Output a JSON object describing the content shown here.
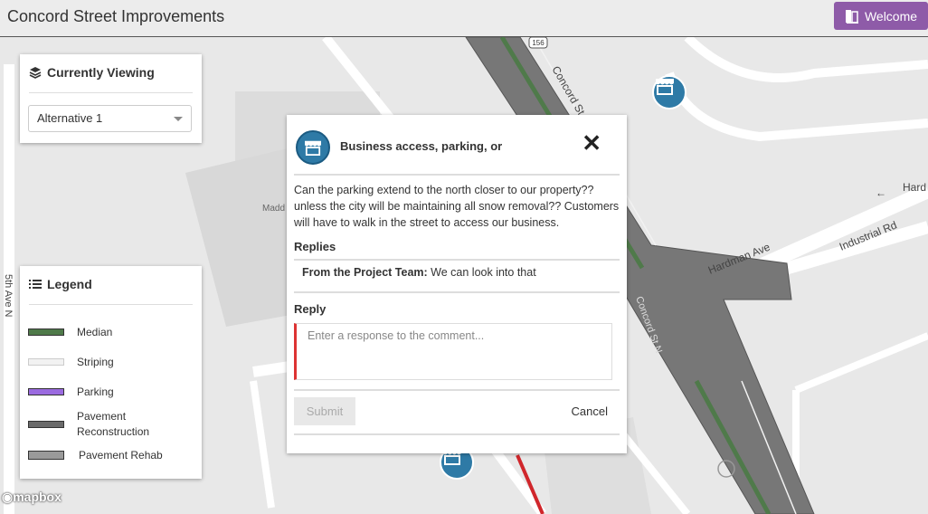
{
  "header": {
    "title": "Concord Street Improvements",
    "welcome_label": "Welcome",
    "accent": "#8e5ba8"
  },
  "map": {
    "street_labels": [
      "Concord St",
      "Hardman Ave",
      "Industrial Rd",
      "Hard",
      "5th Ave N",
      "Concord St N"
    ],
    "route_shield": "156",
    "place_label": "Madd",
    "attribution": "mapbox"
  },
  "viewing": {
    "title": "Currently Viewing",
    "selected": "Alternative 1",
    "icon": "layers-icon"
  },
  "legend": {
    "title": "Legend",
    "icon": "list-icon",
    "items": [
      {
        "label": "Median",
        "color": "#4f7a4a"
      },
      {
        "label": "Striping",
        "color": "#f2f2f2"
      },
      {
        "label": "Parking",
        "color": "#9b6be0"
      },
      {
        "label": "Pavement Reconstruction",
        "color": "#6a6a6a"
      },
      {
        "label": "Pavement Rehab",
        "color": "#9a9a9a"
      }
    ]
  },
  "popup": {
    "title": "Business access, parking, or",
    "comment": "Can the parking extend to the north closer to our property?? unless the city will be maintaining all snow removal?? Customers will have to walk in the street to access our business.",
    "replies_label": "Replies",
    "reply_author": "From the Project Team:",
    "reply_text": "We can look into that",
    "reply_label": "Reply",
    "placeholder": "Enter a response to the comment...",
    "submit_label": "Submit",
    "cancel_label": "Cancel",
    "marker_color": "#2e7aa6"
  }
}
